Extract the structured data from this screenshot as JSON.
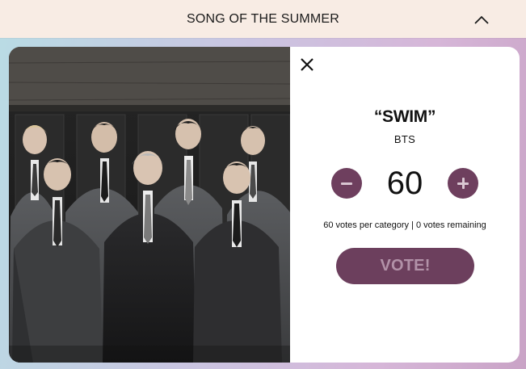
{
  "header": {
    "title": "SONG OF THE SUMMER"
  },
  "card": {
    "song_title": "“SWIM”",
    "artist": "BTS",
    "vote_count": "60",
    "vote_info": "60 votes per category | 0 votes remaining",
    "vote_label": "VOTE!"
  },
  "icons": {
    "collapse": "chevron-up-icon",
    "close": "close-icon",
    "decrement": "minus-icon",
    "increment": "plus-icon"
  },
  "colors": {
    "header_bg": "#f8ece4",
    "accent": "#6c3f5d",
    "accent_text": "#b292a8",
    "card_bg": "#ffffff"
  }
}
